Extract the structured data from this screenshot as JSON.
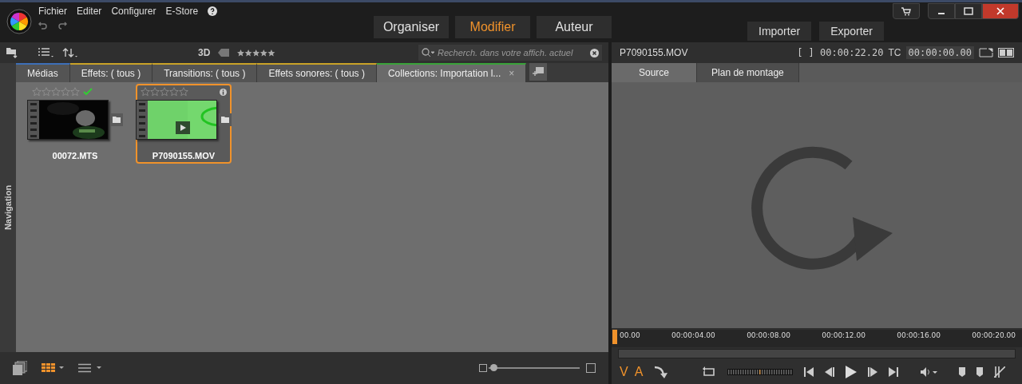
{
  "menu": [
    "Fichier",
    "Editer",
    "Configurer",
    "E-Store"
  ],
  "modes": [
    {
      "label": "Organiser",
      "selected": false
    },
    {
      "label": "Modifier",
      "selected": true
    },
    {
      "label": "Auteur",
      "selected": false
    }
  ],
  "actions": [
    "Importer",
    "Exporter"
  ],
  "library": {
    "toolbar": {
      "three_d": "3D",
      "search_placeholder": "Recherch. dans votre affich. actuel"
    },
    "tabs": [
      {
        "label": "Médias",
        "selected": false,
        "color": "#3d6fb8"
      },
      {
        "label": "Effets: ( tous )",
        "selected": false,
        "color": "#c9a227"
      },
      {
        "label": "Transitions: ( tous )",
        "selected": false,
        "color": "#c9a227"
      },
      {
        "label": "Effets sonores: ( tous )",
        "selected": false,
        "color": "#c9a227"
      },
      {
        "label": "Collections: Importation l...",
        "selected": true,
        "color": "#3aa33a"
      }
    ],
    "tab_close": "×",
    "navigation": "Navigation",
    "items": [
      {
        "name": "00072.MTS",
        "kind": "dark",
        "selected": false,
        "checked": true,
        "stars": 0
      },
      {
        "name": "P7090155.MOV",
        "kind": "green",
        "selected": true,
        "checked": false,
        "stars": 0
      }
    ],
    "zoom": {
      "level": 0.05
    }
  },
  "viewer": {
    "filename": "P7090155.MOV",
    "duration": "[ ] 00:00:22.20",
    "tc_label": "TC",
    "timecode": "00:00:00.00",
    "tabs": [
      {
        "label": "Source",
        "selected": true
      },
      {
        "label": "Plan de montage",
        "selected": false
      }
    ],
    "ruler": [
      "00.00",
      "00:00:04.00",
      "00:00:08.00",
      "00:00:12.00",
      "00:00:16.00",
      "00:00:20.00"
    ],
    "playhead": {
      "level": 0
    },
    "video_label": "V",
    "audio_label": "A"
  }
}
